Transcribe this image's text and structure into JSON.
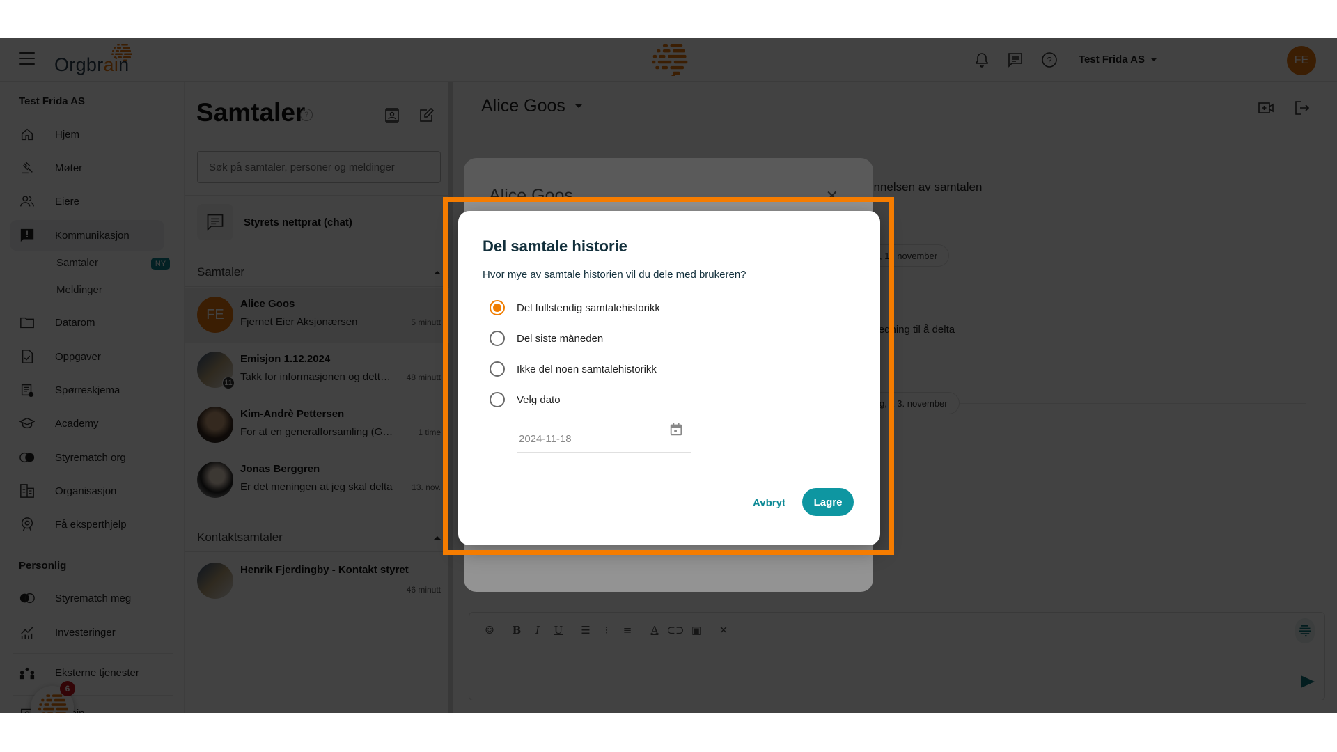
{
  "topbar": {
    "logo_prefix": "Orgbr",
    "logo_accent": "ai",
    "logo_suffix": "n",
    "org_selector": "Test Frida AS",
    "user_initials": "FE"
  },
  "sidebar": {
    "org_section": "Test Frida AS",
    "items": [
      {
        "label": "Hjem",
        "icon": "home-icon"
      },
      {
        "label": "Møter",
        "icon": "gavel-icon"
      },
      {
        "label": "Eiere",
        "icon": "people-icon"
      },
      {
        "label": "Kommunikasjon",
        "icon": "feedback-icon",
        "active": true
      },
      {
        "label": "Datarom",
        "icon": "folder-icon"
      },
      {
        "label": "Oppgaver",
        "icon": "task-icon"
      },
      {
        "label": "Spørreskjema",
        "icon": "survey-icon"
      },
      {
        "label": "Academy",
        "icon": "school-icon"
      },
      {
        "label": "Styrematch org",
        "icon": "match-icon"
      },
      {
        "label": "Organisasjon",
        "icon": "building-icon"
      },
      {
        "label": "Få eksperthjelp",
        "icon": "expert-icon"
      }
    ],
    "sub_items": [
      {
        "label": "Samtaler",
        "badge": "NY"
      },
      {
        "label": "Meldinger"
      }
    ],
    "personal_section": "Personlig",
    "personal_items": [
      {
        "label": "Styrematch meg",
        "icon": "match-icon"
      },
      {
        "label": "Investeringer",
        "icon": "chart-icon"
      },
      {
        "label": "Eksterne tjenester",
        "icon": "services-icon"
      },
      {
        "label": "Admin",
        "icon": "admin-icon"
      }
    ],
    "assistant_badge": "6"
  },
  "conversations": {
    "title": "Samtaler",
    "help": "?",
    "search_placeholder": "Søk på samtaler, personer og meldinger",
    "board_chat": "Styrets nettprat (chat)",
    "group_label": "Samtaler",
    "items": [
      {
        "name": "Alice Goos",
        "message": "Fjernet Eier Aksjonærsen",
        "time": "5 minutt",
        "initials": "FE"
      },
      {
        "name": "Emisjon 1.12.2024",
        "message": "Takk for informasjonen og dette møtet",
        "time": "48 minutt",
        "unread": "11"
      },
      {
        "name": "Kim-Andrè Pettersen",
        "message": "For at en generalforsamling (GF) skal være gyldig",
        "time": "1 time"
      },
      {
        "name": "Jonas Berggren",
        "message": "Er det meningen at jeg skal delta",
        "time": "13. nov."
      }
    ],
    "contact_group_label": "Kontaktsamtaler",
    "contact_items": [
      {
        "name": "Henrik Fjerdingby - Kontakt styret",
        "time": "46 minutt"
      }
    ]
  },
  "chat": {
    "title": "Alice Goos",
    "line1": "ynnelsen av samtalen",
    "date1": ", 1 . november",
    "line2": "a ledning til å delta",
    "date2": "g, 1 3. november"
  },
  "underlying_dialog": {
    "title": "Alice Goos"
  },
  "dialog": {
    "title": "Del samtale historie",
    "question": "Hvor mye av samtale historien vil du dele med brukeren?",
    "options": [
      {
        "label": "Del fullstendig samtalehistorikk",
        "selected": true
      },
      {
        "label": "Del siste måneden",
        "selected": false
      },
      {
        "label": "Ikke del noen samtalehistorikk",
        "selected": false
      },
      {
        "label": "Velg dato",
        "selected": false
      }
    ],
    "date_value": "2024-11-18",
    "cancel_label": "Avbryt",
    "save_label": "Lagre"
  },
  "colors": {
    "accent_orange": "#f07d00",
    "teal": "#0e96a1",
    "highlight": "#f57c00"
  }
}
